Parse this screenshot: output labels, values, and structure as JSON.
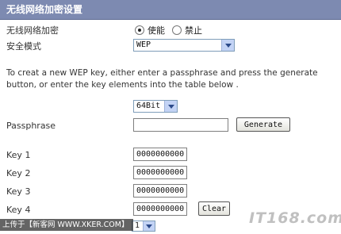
{
  "header": {
    "title": "无线网络加密设置"
  },
  "wireless_encryption": {
    "label": "无线网络加密",
    "options": [
      {
        "label": "使能",
        "selected": true
      },
      {
        "label": "禁止",
        "selected": false
      }
    ]
  },
  "security_mode": {
    "label": "安全模式",
    "value": "WEP"
  },
  "description": "To creat a new WEP key, either enter a passphrase and press the generate button, or enter the key elements into the table below .",
  "key_length": {
    "value": "64Bit"
  },
  "passphrase": {
    "label": "Passphrase",
    "value": "",
    "button": "Generate"
  },
  "keys": [
    {
      "label": "Key 1",
      "value": "0000000000"
    },
    {
      "label": "Key 2",
      "value": "0000000000"
    },
    {
      "label": "Key 3",
      "value": "0000000000"
    },
    {
      "label": "Key 4",
      "value": "0000000000"
    }
  ],
  "clear_button": "Clear",
  "default_key": {
    "value": "1"
  },
  "watermark": {
    "caption": "上传于【新客网 WWW.XKER.COM】",
    "logo": "IT168.com"
  }
}
